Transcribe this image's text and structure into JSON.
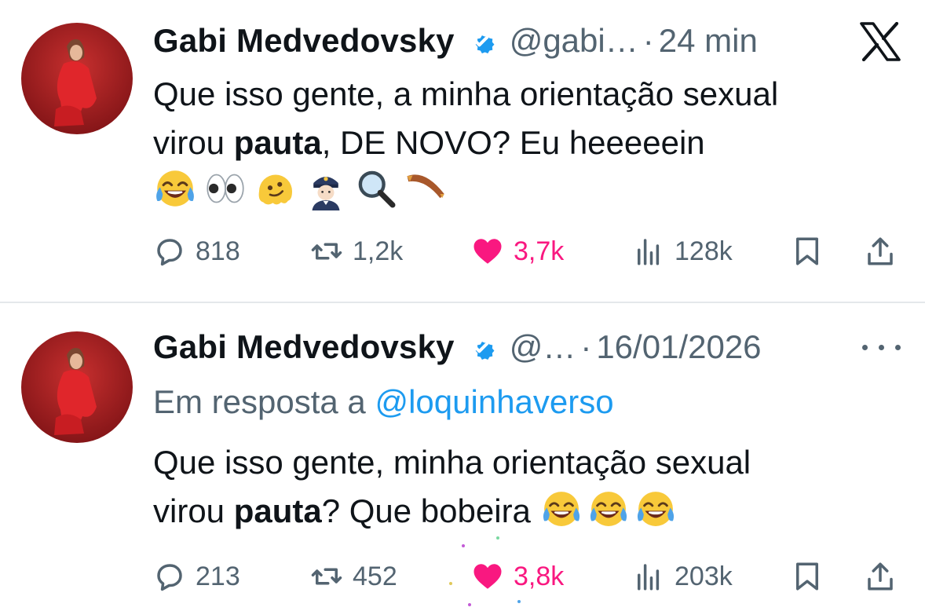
{
  "app": {
    "logo": "x-logo-icon"
  },
  "colors": {
    "text": "#0f1419",
    "secondary": "#536471",
    "link": "#1d9bf0",
    "like": "#f91880",
    "verified": "#1d9bf0",
    "divider": "#e4e8eb"
  },
  "tweets": [
    {
      "author": {
        "name": "Gabi Medvedovsky",
        "handle": "@gabi…",
        "verified": true
      },
      "separator": "·",
      "time": "24 min",
      "text_lines": [
        {
          "before": "Que isso gente, a minha orientação sexual",
          "bold": "",
          "after": ""
        },
        {
          "before": "virou ",
          "bold": "pauta",
          "after": ", DE NOVO? Eu heeeeein"
        }
      ],
      "emojis": [
        "face-with-tears-of-joy",
        "eyes",
        "melting-face",
        "police-officer",
        "magnifying-glass",
        "boomerang"
      ],
      "actions": {
        "replies": "818",
        "reposts": "1,2k",
        "likes": "3,7k",
        "views": "128k",
        "liked": true
      }
    },
    {
      "author": {
        "name": "Gabi Medvedovsky",
        "handle": "@…",
        "verified": true
      },
      "separator": "·",
      "time": "16/01/2026",
      "reply_to": {
        "prefix": "Em resposta a ",
        "mention": "@loquinhaverso"
      },
      "text_lines": [
        {
          "before": "Que isso gente, minha orientação sexual",
          "bold": "",
          "after": ""
        },
        {
          "before": "virou ",
          "bold": "pauta",
          "after": "? Que bobeira"
        }
      ],
      "inline_emojis": [
        "face-with-tears-of-joy",
        "face-with-tears-of-joy",
        "face-with-tears-of-joy"
      ],
      "actions": {
        "replies": "213",
        "reposts": "452",
        "likes": "3,8k",
        "views": "203k",
        "liked": true
      }
    }
  ]
}
